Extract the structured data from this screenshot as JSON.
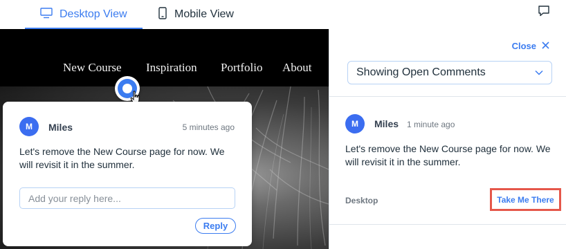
{
  "view_tabs": {
    "desktop_label": "Desktop View",
    "mobile_label": "Mobile View",
    "active": "desktop"
  },
  "site": {
    "nav": [
      "New Course",
      "Inspiration",
      "Portfolio",
      "About"
    ]
  },
  "popup": {
    "avatar_initial": "M",
    "author": "Miles",
    "time": "5 minutes ago",
    "body": "Let's remove the New Course page for now. We will revisit it in the summer.",
    "reply_placeholder": "Add your reply here...",
    "reply_label": "Reply"
  },
  "panel": {
    "close_label": "Close",
    "filter_value": "Showing Open Comments",
    "comment": {
      "avatar_initial": "M",
      "author": "Miles",
      "time": "1 minute ago",
      "body": "Let's remove the New Course page for now. We will revisit it in the summer.",
      "platform": "Desktop",
      "action_label": "Take Me There"
    }
  },
  "colors": {
    "accent": "#3b7cf0",
    "avatar": "#3b6df0",
    "highlight": "#e5574a"
  }
}
